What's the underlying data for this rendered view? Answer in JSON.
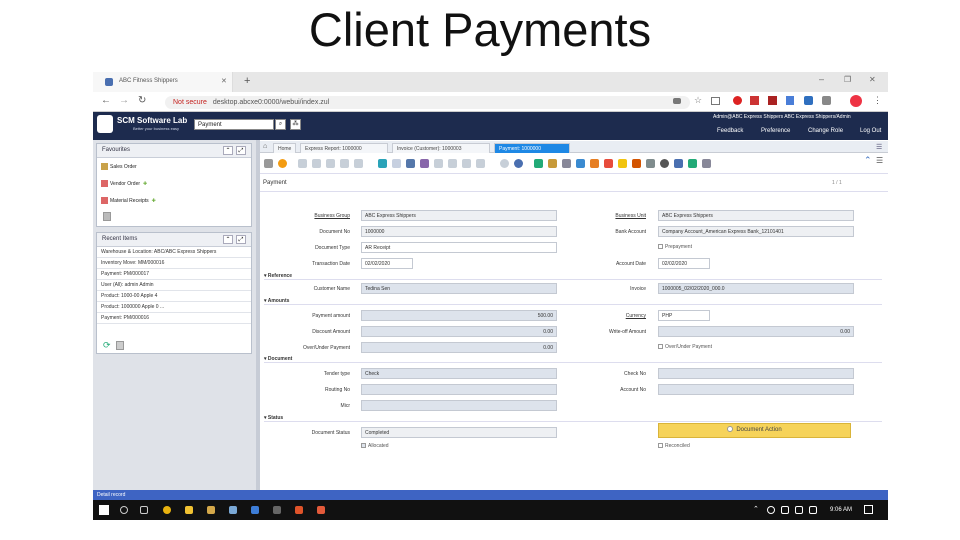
{
  "slide_title": "Client Payments",
  "browser": {
    "tab_title": "ABC Fitness Shippers",
    "new_tab": "+",
    "not_secure": "Not secure",
    "url": "desktop.abcxe0:0000/webui/index.zul"
  },
  "header": {
    "brand": "SCM Software Lab",
    "tagline": "Better your business easy",
    "search_value": "Payment",
    "user_info": "Admin@ABC Express Shippers ABC Express Shippers/Admin",
    "links": [
      "Feedback",
      "Preference",
      "Change Role",
      "Log Out"
    ]
  },
  "favourites": {
    "title": "Favourites",
    "items": [
      "Sales Order",
      "Vendor Order",
      "Material Receipts"
    ]
  },
  "recent": {
    "title": "Recent Items",
    "items": [
      "Warehouse & Location: ABC/ABC Express Shippers",
      "Inventory Move: MM/000016",
      "Payment: PM/000017",
      "User (All): admin Admin",
      "Product: 1000-00 Apple 4",
      "Product: 1000000 Apple 0 ...",
      "Payment: PM/000016"
    ]
  },
  "window_tabs": [
    "Home",
    "Express Report: 1000000",
    "Invoice (Customer): 1000003",
    "Payment: 1000000"
  ],
  "form": {
    "tab": "Payment",
    "pager": "1 / 1",
    "business_group_label": "Business Group",
    "business_group": "ABC Express Shippers",
    "business_unit_label": "Business Unit",
    "business_unit": "ABC Express Shippers",
    "document_no_label": "Document No",
    "document_no": "1000000",
    "bank_account_label": "Bank Account",
    "bank_account": "Company Account_American Express Bank_12101401",
    "document_type_label": "Document Type",
    "document_type": "AR Receipt",
    "prepayment_label": "Prepayment",
    "transaction_date_label": "Transaction Date",
    "transaction_date": "02/02/2020",
    "account_date_label": "Account Date",
    "account_date": "02/02/2020",
    "reference_label": "Reference",
    "customer_name_label": "Customer Name",
    "customer_name": "Tedina Sen",
    "invoice_label": "Invoice",
    "invoice": "1000005_02/02/2020_000.0",
    "amounts_label": "Amounts",
    "payment_amount_label": "Payment amount",
    "payment_amount": "500.00",
    "currency_label": "Currency",
    "currency": "PHP",
    "discount_amount_label": "Discount Amount",
    "discount_amount": "0.00",
    "writeoff_amount_label": "Write-off Amount",
    "writeoff_amount": "0.00",
    "overunder_label": "Over/Under Payment",
    "overunder_amount": "0.00",
    "overunder_chk": "Over/Under Payment",
    "document_label": "Document",
    "tender_type_label": "Tender type",
    "tender_type": "Check",
    "check_no_label": "Check No",
    "check_no": "",
    "routing_no_label": "Routing No",
    "routing_no": "",
    "account_no_label": "Account No",
    "account_no": "",
    "micr_label": "Micr",
    "micr": "",
    "status_label": "Status",
    "document_status_label": "Document Status",
    "document_status": "Completed",
    "document_action": "Document Action",
    "allocated": "Allocated",
    "reconciled": "Reconciled"
  },
  "statusbar": "Detail record",
  "taskbar": {
    "time": "9:06 AM"
  },
  "colors": {
    "header": "#1d2b4e",
    "active_tab": "#1e88e5",
    "doc_action": "#f6d35a",
    "statusbar": "#3e64c3"
  }
}
